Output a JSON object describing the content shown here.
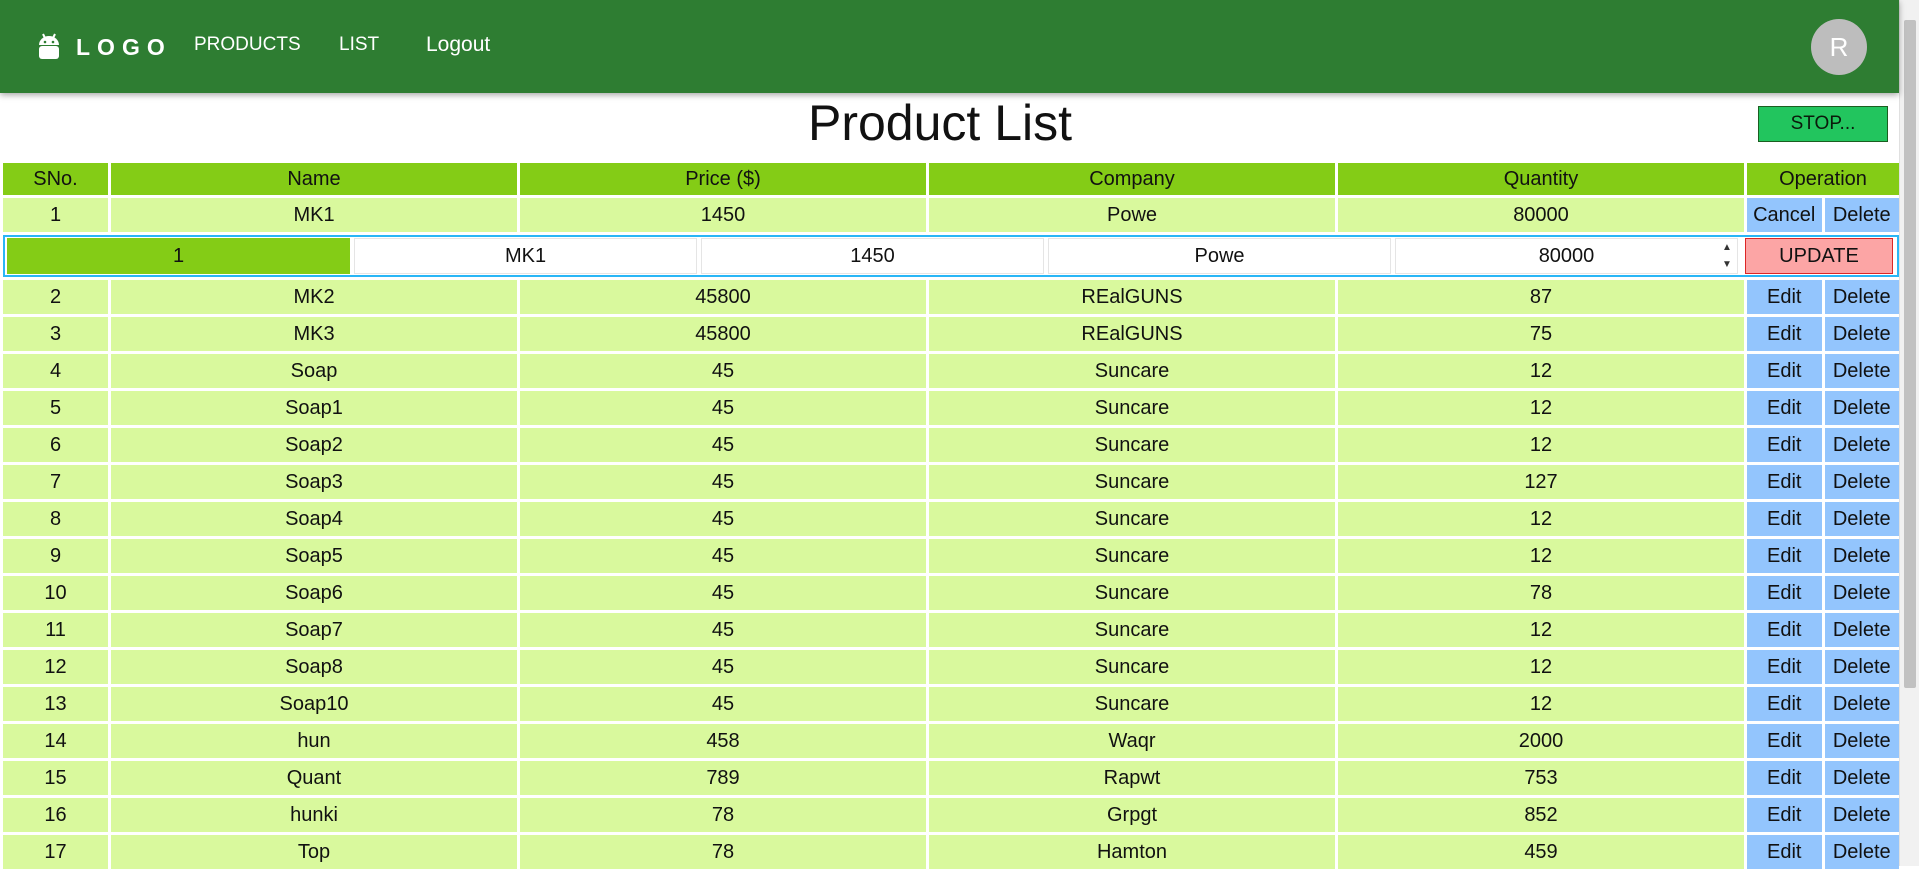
{
  "nav": {
    "logo_text": "LOGO",
    "logo_icon": "android-icon",
    "links": [
      "PRODUCTS",
      "LIST"
    ],
    "logout": "Logout",
    "avatar_initial": "R"
  },
  "page": {
    "title": "Product List",
    "stop_button": "STOP..."
  },
  "table": {
    "headers": [
      "SNo.",
      "Name",
      "Price ($)",
      "Company",
      "Quantity",
      "Operation"
    ],
    "rows": [
      {
        "sno": "1",
        "name": "MK1",
        "price": "1450",
        "company": "Powe",
        "quantity": "80000",
        "op1": "Cancel",
        "op2": "Delete"
      },
      {
        "sno": "2",
        "name": "MK2",
        "price": "45800",
        "company": "REalGUNS",
        "quantity": "87",
        "op1": "Edit",
        "op2": "Delete"
      },
      {
        "sno": "3",
        "name": "MK3",
        "price": "45800",
        "company": "REalGUNS",
        "quantity": "75",
        "op1": "Edit",
        "op2": "Delete"
      },
      {
        "sno": "4",
        "name": "Soap",
        "price": "45",
        "company": "Suncare",
        "quantity": "12",
        "op1": "Edit",
        "op2": "Delete"
      },
      {
        "sno": "5",
        "name": "Soap1",
        "price": "45",
        "company": "Suncare",
        "quantity": "12",
        "op1": "Edit",
        "op2": "Delete"
      },
      {
        "sno": "6",
        "name": "Soap2",
        "price": "45",
        "company": "Suncare",
        "quantity": "12",
        "op1": "Edit",
        "op2": "Delete"
      },
      {
        "sno": "7",
        "name": "Soap3",
        "price": "45",
        "company": "Suncare",
        "quantity": "127",
        "op1": "Edit",
        "op2": "Delete"
      },
      {
        "sno": "8",
        "name": "Soap4",
        "price": "45",
        "company": "Suncare",
        "quantity": "12",
        "op1": "Edit",
        "op2": "Delete"
      },
      {
        "sno": "9",
        "name": "Soap5",
        "price": "45",
        "company": "Suncare",
        "quantity": "12",
        "op1": "Edit",
        "op2": "Delete"
      },
      {
        "sno": "10",
        "name": "Soap6",
        "price": "45",
        "company": "Suncare",
        "quantity": "78",
        "op1": "Edit",
        "op2": "Delete"
      },
      {
        "sno": "11",
        "name": "Soap7",
        "price": "45",
        "company": "Suncare",
        "quantity": "12",
        "op1": "Edit",
        "op2": "Delete"
      },
      {
        "sno": "12",
        "name": "Soap8",
        "price": "45",
        "company": "Suncare",
        "quantity": "12",
        "op1": "Edit",
        "op2": "Delete"
      },
      {
        "sno": "13",
        "name": "Soap10",
        "price": "45",
        "company": "Suncare",
        "quantity": "12",
        "op1": "Edit",
        "op2": "Delete"
      },
      {
        "sno": "14",
        "name": "hun",
        "price": "458",
        "company": "Waqr",
        "quantity": "2000",
        "op1": "Edit",
        "op2": "Delete"
      },
      {
        "sno": "15",
        "name": "Quant",
        "price": "789",
        "company": "Rapwt",
        "quantity": "753",
        "op1": "Edit",
        "op2": "Delete"
      },
      {
        "sno": "16",
        "name": "hunki",
        "price": "78",
        "company": "Grpgt",
        "quantity": "852",
        "op1": "Edit",
        "op2": "Delete"
      },
      {
        "sno": "17",
        "name": "Top",
        "price": "78",
        "company": "Hamton",
        "quantity": "459",
        "op1": "Edit",
        "op2": "Delete"
      }
    ],
    "edit_row": {
      "sno": "1",
      "name": "MK1",
      "price": "1450",
      "company": "Powe",
      "quantity": "80000",
      "update_button": "UPDATE"
    }
  },
  "colors": {
    "navbar": "#2e7d32",
    "header_cell": "#84cc16",
    "body_cell": "#d9f99d",
    "op_button": "#93c5fd",
    "update_button": "#fca5a5",
    "stop_button": "#22c55e"
  }
}
